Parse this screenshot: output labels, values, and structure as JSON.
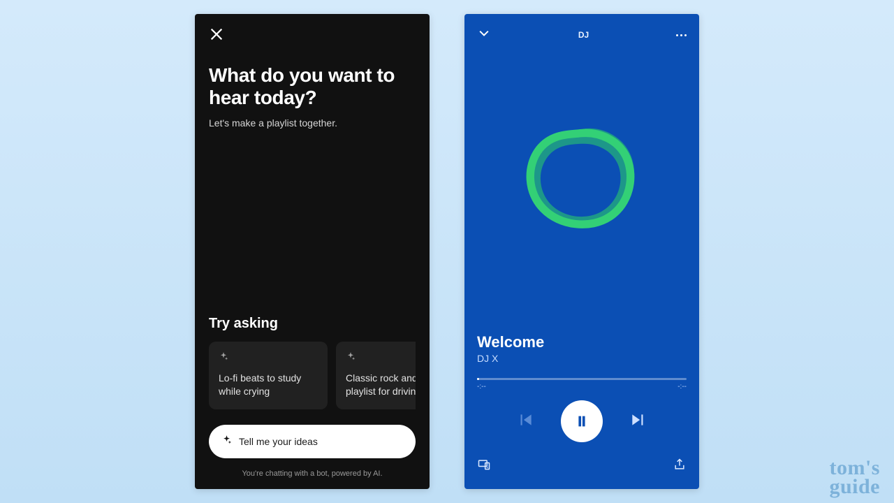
{
  "left": {
    "headline": "What do you want to hear today?",
    "subhead": "Let's make a playlist together.",
    "try_label": "Try asking",
    "cards": [
      "Lo-fi beats to study while crying",
      "Classic rock and metal playlist for driving"
    ],
    "input_placeholder": "Tell me your ideas",
    "disclaimer": "You're chatting with a bot, powered by AI."
  },
  "right": {
    "header_title": "DJ",
    "track_title": "Welcome",
    "track_artist": "DJ X",
    "time_elapsed": "-:--",
    "time_total": "-:--"
  },
  "watermark": {
    "line1": "tom's",
    "line2": "guide"
  },
  "colors": {
    "left_bg": "#111111",
    "right_bg": "#0b4fb4",
    "blob_green": "#33d076",
    "blob_teal": "#1f9f84"
  }
}
